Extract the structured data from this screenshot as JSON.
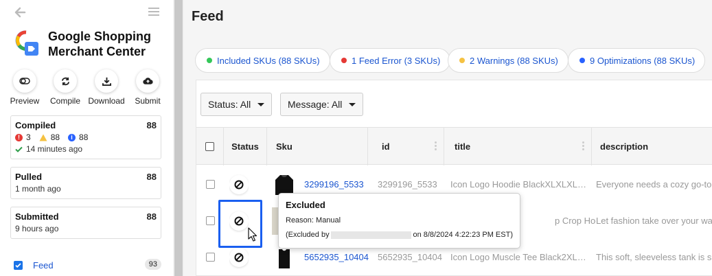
{
  "sidebar": {
    "app_title_line1": "Google Shopping",
    "app_title_line2": "Merchant Center",
    "actions": [
      {
        "label": "Preview",
        "icon": "toggle-icon"
      },
      {
        "label": "Compile",
        "icon": "refresh-icon"
      },
      {
        "label": "Download",
        "icon": "download-icon"
      },
      {
        "label": "Submit",
        "icon": "cloud-upload-icon"
      }
    ],
    "compiled": {
      "title": "Compiled",
      "count": "88",
      "errors": "3",
      "warnings": "88",
      "info": "88",
      "time": "14 minutes ago"
    },
    "pulled": {
      "title": "Pulled",
      "count": "88",
      "time": "1 month ago"
    },
    "submitted": {
      "title": "Submitted",
      "count": "88",
      "time": "9 hours ago"
    },
    "feed": {
      "label": "Feed",
      "count": "93"
    }
  },
  "main": {
    "title": "Feed",
    "chips": [
      {
        "label": "Included SKUs (88 SKUs)",
        "color": "#34c759"
      },
      {
        "label": "1 Feed Error (3 SKUs)",
        "color": "#e53935"
      },
      {
        "label": "2 Warnings (88 SKUs)",
        "color": "#f5c242"
      },
      {
        "label": "9 Optimizations (88 SKUs)",
        "color": "#2962ff"
      }
    ],
    "filters": {
      "status": "Status: All",
      "message": "Message: All"
    },
    "columns": {
      "status": "Status",
      "sku": "Sku",
      "id": "id",
      "title": "title",
      "description": "description"
    },
    "rows": [
      {
        "sku": "3299196_5533",
        "id": "3299196_5533",
        "title": "Icon Logo Hoodie BlackXLXLXL…",
        "description": "Everyone needs a cozy go-to"
      },
      {
        "sku": "",
        "id": "",
        "title": "p Crop Hoodie…",
        "description": "Let fashion take over your wa"
      },
      {
        "sku": "5652935_10404",
        "id": "5652935_10404",
        "title": "Icon Logo Muscle Tee Black2XL…",
        "description": "This soft, sleeveless tank is s"
      }
    ]
  },
  "tooltip": {
    "title": "Excluded",
    "reason": "Reason: Manual",
    "by_prefix": "(Excluded by",
    "by_suffix": "on 8/8/2024 4:22:23 PM EST)"
  }
}
